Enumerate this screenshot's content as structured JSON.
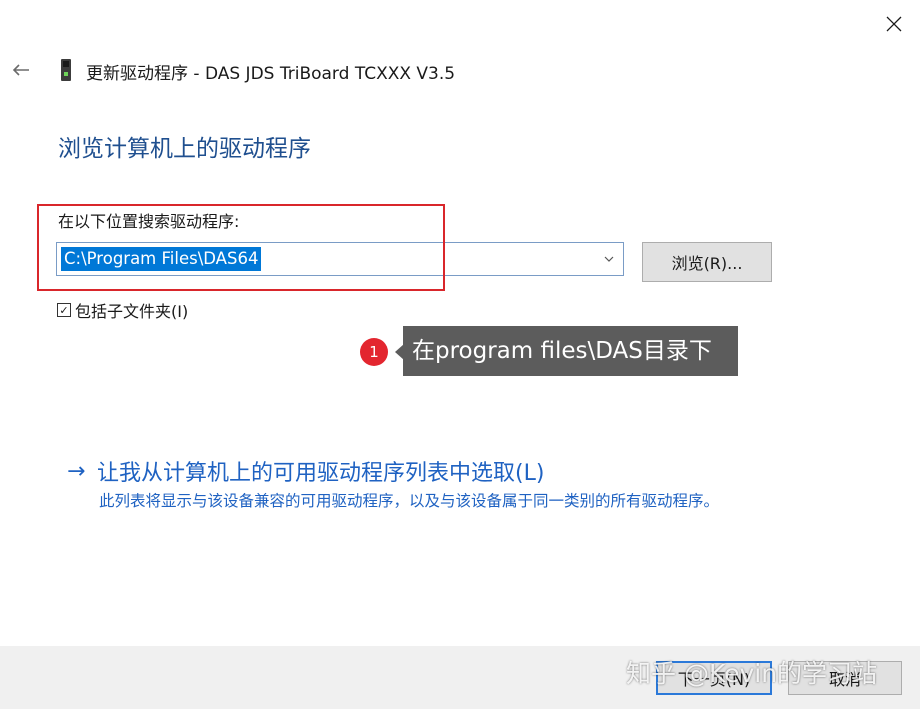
{
  "header": {
    "title": "更新驱动程序 - DAS JDS TriBoard TCXXX V3.5",
    "back_icon": "back-arrow-icon",
    "close_icon": "close-icon",
    "device_icon": "usb-device-icon"
  },
  "main": {
    "heading": "浏览计算机上的驱动程序",
    "search_label": "在以下位置搜索驱动程序:",
    "path_value": "C:\\Program Files\\DAS64",
    "browse_label": "浏览(R)...",
    "include_subfolders_label": "包括子文件夹(I)",
    "include_subfolders_checked": true,
    "pick_link_label": "让我从计算机上的可用驱动程序列表中选取(L)",
    "pick_link_description": "此列表将显示与该设备兼容的可用驱动程序，以及与该设备属于同一类别的所有驱动程序。"
  },
  "annotation": {
    "badge": "1",
    "text": "在program files\\DAS目录下"
  },
  "footer": {
    "next_label": "下一页(N)",
    "cancel_label": "取消"
  },
  "watermark": "知乎 @Kevin的学习站",
  "colors": {
    "accent": "#0078d7",
    "heading": "#1f4f8f",
    "link": "#1f62c2",
    "highlight_box": "#d9262b",
    "badge": "#e3262f",
    "tooltip": "#5c5c5c"
  }
}
